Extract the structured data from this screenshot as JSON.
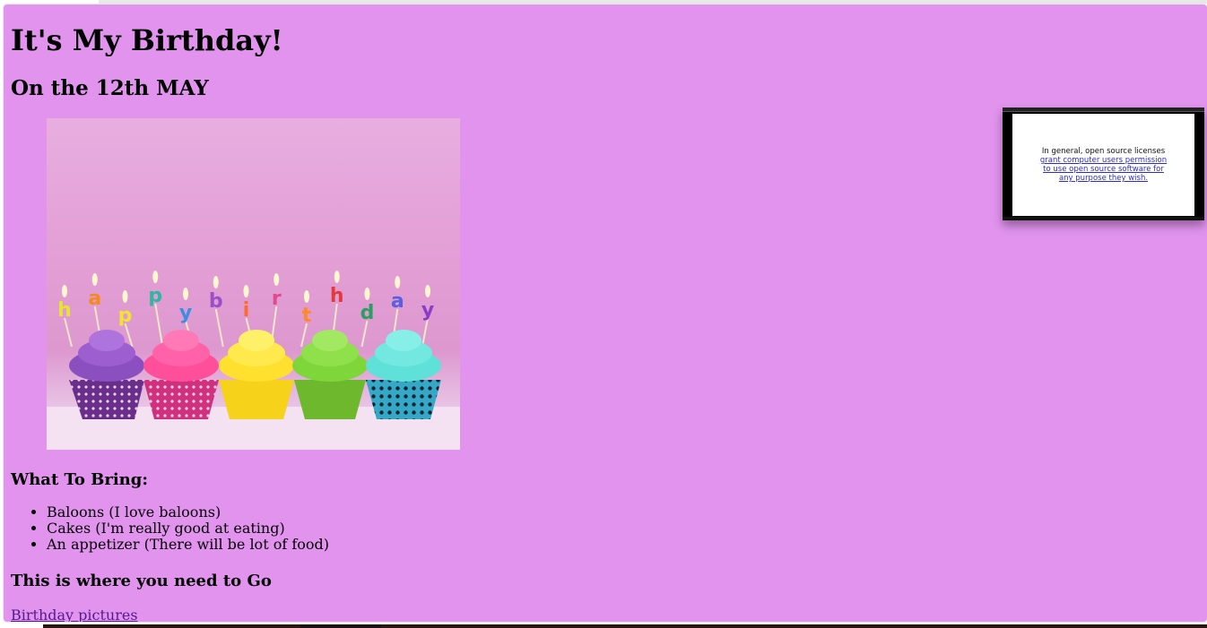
{
  "page": {
    "background_color": "#e193ee",
    "link_color": "#551a8b"
  },
  "header": {
    "title": "It's My Birthday!",
    "subtitle": "On the 12th MAY"
  },
  "photo": {
    "candle_letters": [
      "h",
      "a",
      "p",
      "p",
      "y",
      "b",
      "i",
      "r",
      "t",
      "h",
      "d",
      "a",
      "y"
    ]
  },
  "bring_section": {
    "heading": "What To Bring:",
    "items": [
      "Baloons (I love baloons)",
      "Cakes (I'm really good at eating)",
      "An appetizer (There will be lot of food)"
    ]
  },
  "where_section": {
    "heading": "This is where you need to Go"
  },
  "link": {
    "label": "Birthday pictures"
  },
  "video": {
    "plain_text": "In general, open source licenses",
    "link_text": "grant computer users permission to use open source software for any purpose they wish."
  }
}
